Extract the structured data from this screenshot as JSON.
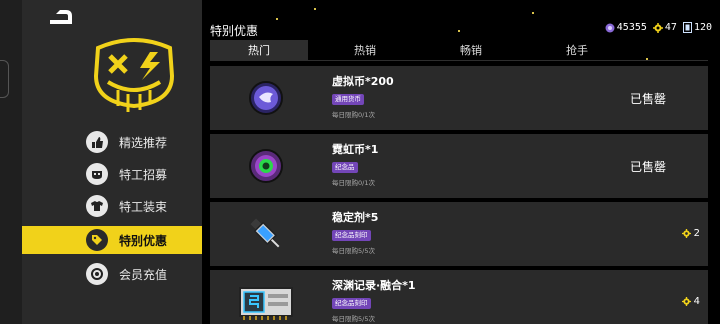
{
  "header": {
    "title": "特别优惠"
  },
  "currencies": [
    {
      "icon": "purple-coin-icon",
      "value": "45355"
    },
    {
      "icon": "gold-gear-icon",
      "value": "47"
    },
    {
      "icon": "ticket-icon",
      "value": "120"
    }
  ],
  "tabs": [
    {
      "label": "热门",
      "active": true
    },
    {
      "label": "热销",
      "active": false
    },
    {
      "label": "畅销",
      "active": false
    },
    {
      "label": "抢手",
      "active": false
    }
  ],
  "sidebar": {
    "items": [
      {
        "label": "精选推荐",
        "icon": "thumbs-up-icon",
        "active": false
      },
      {
        "label": "特工招募",
        "icon": "agent-mask-icon",
        "active": false
      },
      {
        "label": "特工装束",
        "icon": "outfit-icon",
        "active": false
      },
      {
        "label": "特别优惠",
        "icon": "sale-tag-icon",
        "active": true
      },
      {
        "label": "会员充值",
        "icon": "member-coin-icon",
        "active": false
      }
    ]
  },
  "products": [
    {
      "name": "虚拟币*200",
      "badge": "通用货币",
      "limit": "每日限购0/1次",
      "status": "已售罄",
      "price": null,
      "icon": "virtual-coin-icon"
    },
    {
      "name": "霓虹币*1",
      "badge": "纪念品",
      "limit": "每日限购0/1次",
      "status": "已售罄",
      "price": null,
      "icon": "neon-coin-icon"
    },
    {
      "name": "稳定剂*5",
      "badge": "纪念品刻印",
      "limit": "每日限购5/5次",
      "status": null,
      "price": "2",
      "icon": "stabilizer-syringe-icon"
    },
    {
      "name": "深渊记录·融合*1",
      "badge": "纪念品刻印",
      "limit": "每日限购5/5次",
      "status": null,
      "price": "4",
      "icon": "abyss-record-card-icon"
    }
  ],
  "colors": {
    "accent": "#f1d21a",
    "badge": "#7346b8",
    "panel": "#2a2a2a"
  }
}
